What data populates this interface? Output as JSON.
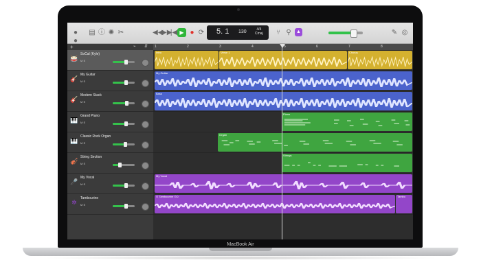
{
  "brand_label": "MacBook Air",
  "toolbar": {
    "lcd_position": "5. 1",
    "lcd_tempo": "130",
    "lcd_sig_top": "4/4",
    "lcd_sig_bottom": "Cmaj",
    "icons_left": [
      "library-icon",
      "info-icon",
      "smart-controls-icon",
      "editors-icon"
    ],
    "transport": [
      "rewind-icon",
      "fast-forward-icon",
      "to-start-icon",
      "play-icon",
      "record-icon",
      "cycle-icon"
    ],
    "master_volume": 0.72
  },
  "ruler": {
    "marks": [
      "1",
      "2",
      "3",
      "4",
      "5",
      "6",
      "7",
      "8"
    ]
  },
  "tracks": [
    {
      "name": "SoCal (Kyle)",
      "icon": "drummer-icon",
      "color": "#c9a72b",
      "volume": 0.6,
      "selected": true
    },
    {
      "name": "My Guitar",
      "icon": "guitar-icon",
      "color": "#4a62c8",
      "volume": 0.6
    },
    {
      "name": "Modern Stack",
      "icon": "bass-icon",
      "color": "#4a62c8",
      "volume": 0.62
    },
    {
      "name": "Grand Piano",
      "icon": "piano-icon",
      "color": "#3aa03d",
      "volume": 0.58
    },
    {
      "name": "Classic Rock Organ",
      "icon": "organ-icon",
      "color": "#3aa03d",
      "volume": 0.55
    },
    {
      "name": "String Section",
      "icon": "strings-icon",
      "color": "#3aa03d",
      "volume": 0.3
    },
    {
      "name": "My Vocal",
      "icon": "mic-icon",
      "color": "#8e44c4",
      "volume": 0.6
    },
    {
      "name": "Tambourine",
      "icon": "tambourine-icon",
      "color": "#8e44c4",
      "volume": 0.6
    }
  ],
  "mute_solo": "M S",
  "regions": {
    "drummer": [
      "Intro",
      "Verse 1",
      "Chorus"
    ],
    "guitar": "My Guitar",
    "bass": "Bass",
    "piano": "Piano",
    "organ": "Organ",
    "strings": "Strings",
    "vocal": "My Vocal",
    "tambourine": "⊙ Tambourine ⊙D",
    "tambourine_end": "Tambo"
  }
}
